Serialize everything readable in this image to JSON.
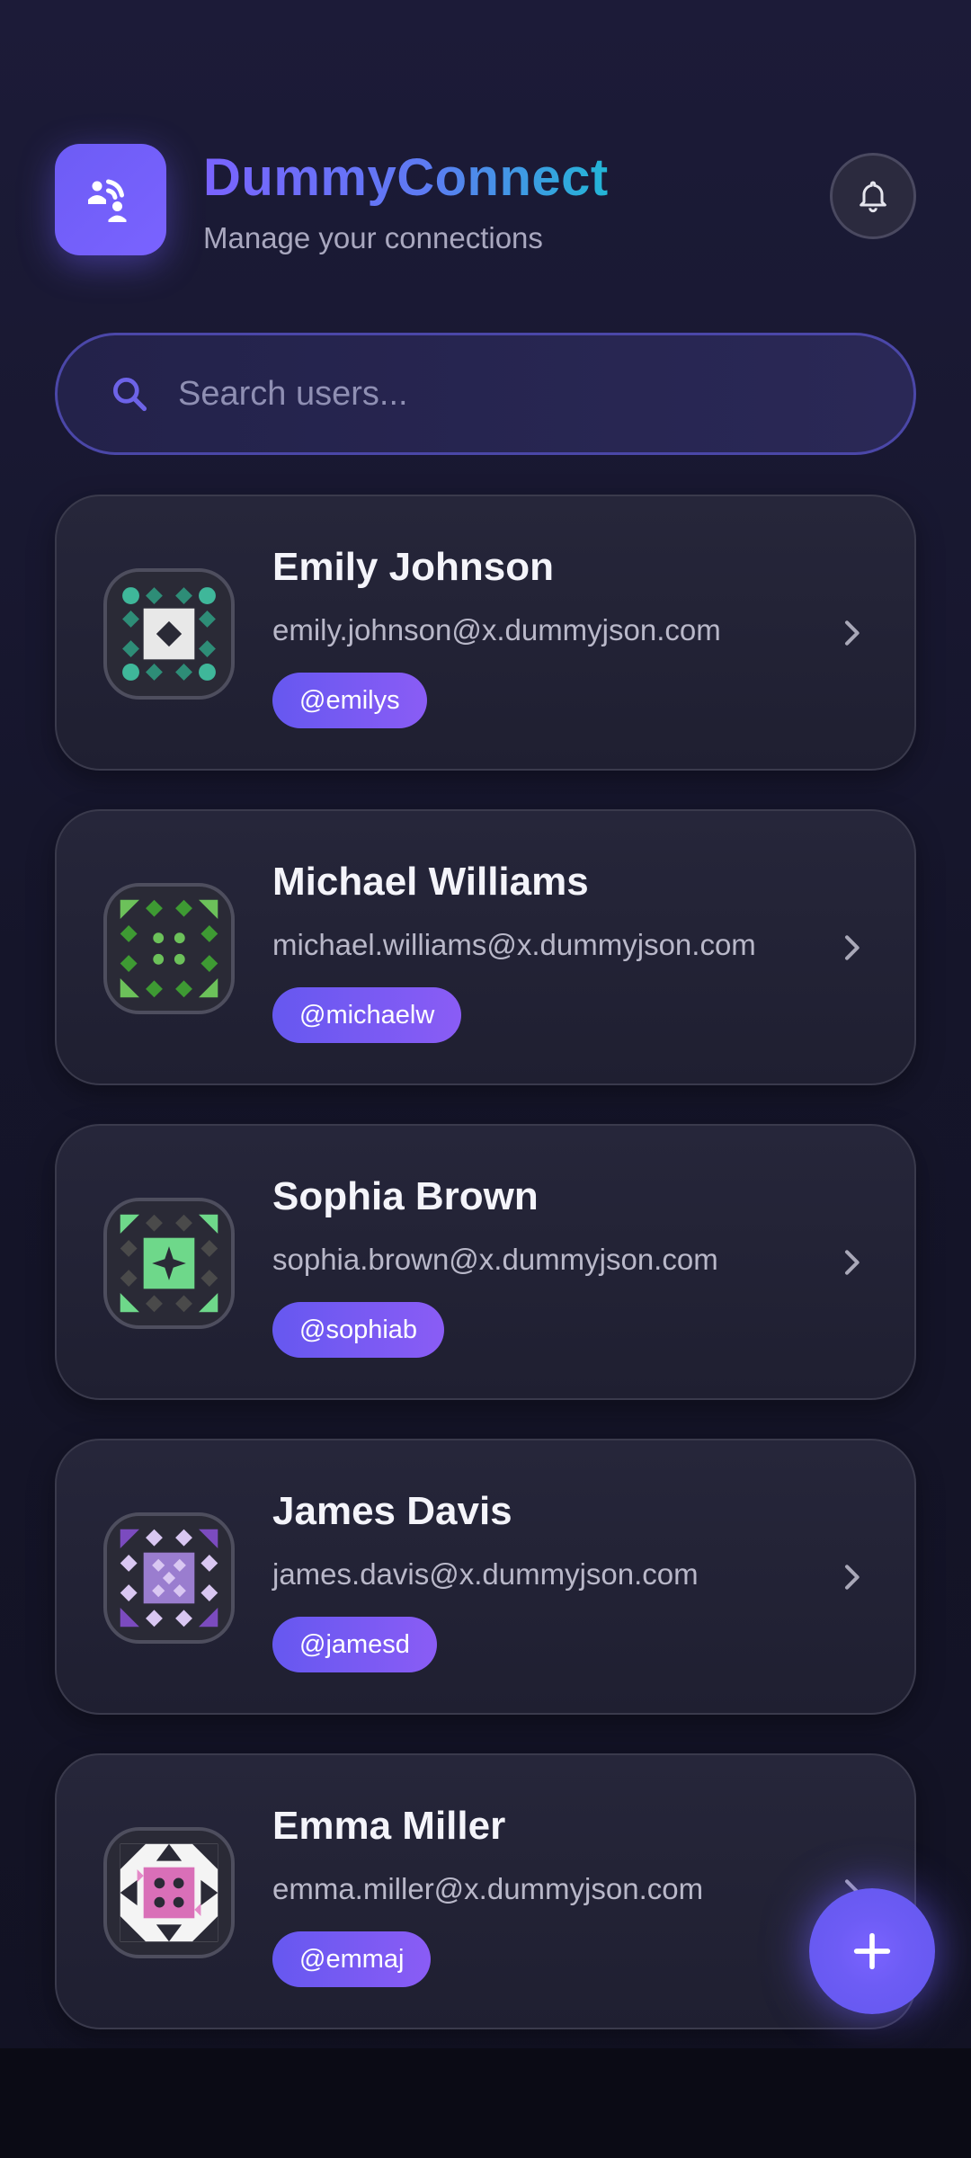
{
  "app": {
    "title": "DummyConnect",
    "subtitle": "Manage your connections",
    "logo_icon": "connection-icon",
    "notification_icon": "bell-icon"
  },
  "search": {
    "placeholder": "Search users...",
    "value": "",
    "icon": "search-icon"
  },
  "users": [
    {
      "name": "Emily Johnson",
      "email": "emily.johnson@x.dummyjson.com",
      "username": "@emilys",
      "avatar_colors": [
        "#3fb79a",
        "#2e8d77",
        "#e8e8e8",
        "#2a2a36"
      ]
    },
    {
      "name": "Michael Williams",
      "email": "michael.williams@x.dummyjson.com",
      "username": "@michaelw",
      "avatar_colors": [
        "#6cc15a",
        "#3e9a33",
        "#e8e8e8",
        "#2a2a36"
      ]
    },
    {
      "name": "Sophia Brown",
      "email": "sophia.brown@x.dummyjson.com",
      "username": "@sophiab",
      "avatar_colors": [
        "#6ed88a",
        "#4a4a4a",
        "#2a2a36",
        "#6ed88a"
      ]
    },
    {
      "name": "James Davis",
      "email": "james.davis@x.dummyjson.com",
      "username": "@jamesd",
      "avatar_colors": [
        "#7b4bbf",
        "#d9c7f2",
        "#9a7dcf",
        "#2a2a36"
      ]
    },
    {
      "name": "Emma Miller",
      "email": "emma.miller@x.dummyjson.com",
      "username": "@emmaj",
      "avatar_colors": [
        "#d96fb8",
        "#f4f4f4",
        "#2a2a36",
        "#e48ac8"
      ]
    }
  ],
  "fab": {
    "icon": "plus-icon"
  },
  "colors": {
    "accent": "#6d5cf5",
    "accent_alt": "#23b6d6",
    "background": "#171629"
  }
}
